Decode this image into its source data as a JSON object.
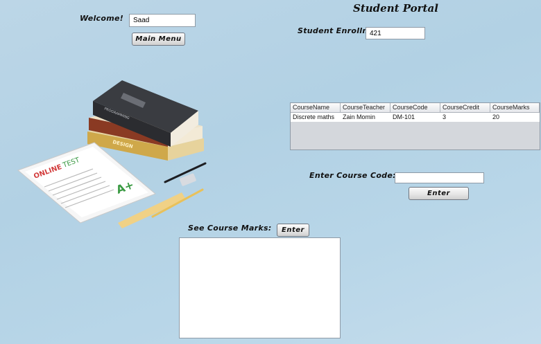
{
  "window": {
    "title": "Student Portal"
  },
  "welcome": {
    "label": "Welcome!",
    "name_value": "Saad"
  },
  "main_menu_button": "Main Menu",
  "enrollment": {
    "label": "Student Enrollment:",
    "value": "421"
  },
  "course_table": {
    "columns": [
      "CourseName",
      "CourseTeacher",
      "CourseCode",
      "CourseCredit",
      "CourseMarks"
    ],
    "rows": [
      [
        "Discrete maths",
        "Zain Momin",
        "DM-101",
        "3",
        "20"
      ]
    ]
  },
  "course_code": {
    "label": "Enter Course Code:",
    "value": "",
    "button": "Enter"
  },
  "course_marks": {
    "label": "See Course Marks:",
    "button": "Enter",
    "output": ""
  },
  "illustration": {
    "book_labels": [
      "PROGRAMMING",
      "DESIGN"
    ],
    "tablet_text": {
      "online": "ONLINE",
      "test": "TEST",
      "grade": "A+"
    }
  },
  "colors": {
    "background": "#b8d6e8",
    "accent_red": "#d23b3b",
    "accent_green": "#3a9a43"
  }
}
